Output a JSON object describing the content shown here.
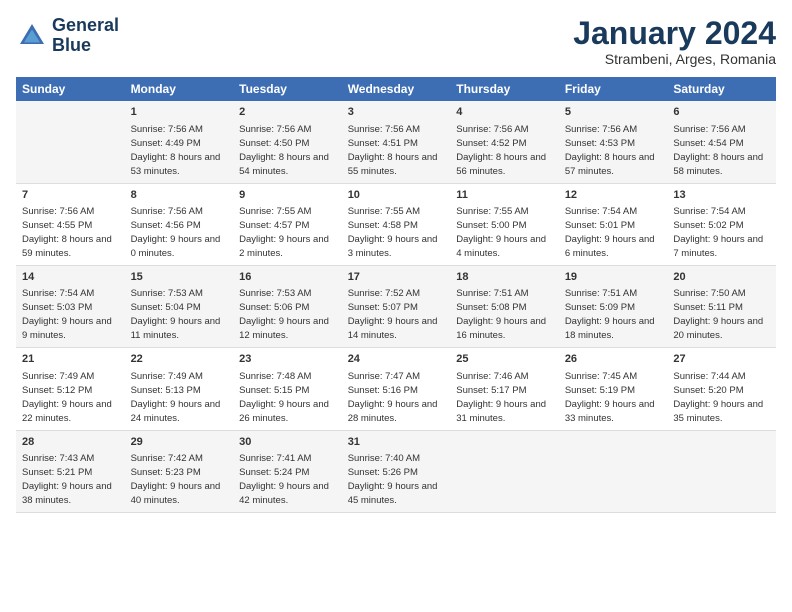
{
  "header": {
    "logo_line1": "General",
    "logo_line2": "Blue",
    "month_title": "January 2024",
    "subtitle": "Strambeni, Arges, Romania"
  },
  "weekdays": [
    "Sunday",
    "Monday",
    "Tuesday",
    "Wednesday",
    "Thursday",
    "Friday",
    "Saturday"
  ],
  "weeks": [
    [
      {
        "day": "",
        "sunrise": "",
        "sunset": "",
        "daylight": ""
      },
      {
        "day": "1",
        "sunrise": "Sunrise: 7:56 AM",
        "sunset": "Sunset: 4:49 PM",
        "daylight": "Daylight: 8 hours and 53 minutes."
      },
      {
        "day": "2",
        "sunrise": "Sunrise: 7:56 AM",
        "sunset": "Sunset: 4:50 PM",
        "daylight": "Daylight: 8 hours and 54 minutes."
      },
      {
        "day": "3",
        "sunrise": "Sunrise: 7:56 AM",
        "sunset": "Sunset: 4:51 PM",
        "daylight": "Daylight: 8 hours and 55 minutes."
      },
      {
        "day": "4",
        "sunrise": "Sunrise: 7:56 AM",
        "sunset": "Sunset: 4:52 PM",
        "daylight": "Daylight: 8 hours and 56 minutes."
      },
      {
        "day": "5",
        "sunrise": "Sunrise: 7:56 AM",
        "sunset": "Sunset: 4:53 PM",
        "daylight": "Daylight: 8 hours and 57 minutes."
      },
      {
        "day": "6",
        "sunrise": "Sunrise: 7:56 AM",
        "sunset": "Sunset: 4:54 PM",
        "daylight": "Daylight: 8 hours and 58 minutes."
      }
    ],
    [
      {
        "day": "7",
        "sunrise": "Sunrise: 7:56 AM",
        "sunset": "Sunset: 4:55 PM",
        "daylight": "Daylight: 8 hours and 59 minutes."
      },
      {
        "day": "8",
        "sunrise": "Sunrise: 7:56 AM",
        "sunset": "Sunset: 4:56 PM",
        "daylight": "Daylight: 9 hours and 0 minutes."
      },
      {
        "day": "9",
        "sunrise": "Sunrise: 7:55 AM",
        "sunset": "Sunset: 4:57 PM",
        "daylight": "Daylight: 9 hours and 2 minutes."
      },
      {
        "day": "10",
        "sunrise": "Sunrise: 7:55 AM",
        "sunset": "Sunset: 4:58 PM",
        "daylight": "Daylight: 9 hours and 3 minutes."
      },
      {
        "day": "11",
        "sunrise": "Sunrise: 7:55 AM",
        "sunset": "Sunset: 5:00 PM",
        "daylight": "Daylight: 9 hours and 4 minutes."
      },
      {
        "day": "12",
        "sunrise": "Sunrise: 7:54 AM",
        "sunset": "Sunset: 5:01 PM",
        "daylight": "Daylight: 9 hours and 6 minutes."
      },
      {
        "day": "13",
        "sunrise": "Sunrise: 7:54 AM",
        "sunset": "Sunset: 5:02 PM",
        "daylight": "Daylight: 9 hours and 7 minutes."
      }
    ],
    [
      {
        "day": "14",
        "sunrise": "Sunrise: 7:54 AM",
        "sunset": "Sunset: 5:03 PM",
        "daylight": "Daylight: 9 hours and 9 minutes."
      },
      {
        "day": "15",
        "sunrise": "Sunrise: 7:53 AM",
        "sunset": "Sunset: 5:04 PM",
        "daylight": "Daylight: 9 hours and 11 minutes."
      },
      {
        "day": "16",
        "sunrise": "Sunrise: 7:53 AM",
        "sunset": "Sunset: 5:06 PM",
        "daylight": "Daylight: 9 hours and 12 minutes."
      },
      {
        "day": "17",
        "sunrise": "Sunrise: 7:52 AM",
        "sunset": "Sunset: 5:07 PM",
        "daylight": "Daylight: 9 hours and 14 minutes."
      },
      {
        "day": "18",
        "sunrise": "Sunrise: 7:51 AM",
        "sunset": "Sunset: 5:08 PM",
        "daylight": "Daylight: 9 hours and 16 minutes."
      },
      {
        "day": "19",
        "sunrise": "Sunrise: 7:51 AM",
        "sunset": "Sunset: 5:09 PM",
        "daylight": "Daylight: 9 hours and 18 minutes."
      },
      {
        "day": "20",
        "sunrise": "Sunrise: 7:50 AM",
        "sunset": "Sunset: 5:11 PM",
        "daylight": "Daylight: 9 hours and 20 minutes."
      }
    ],
    [
      {
        "day": "21",
        "sunrise": "Sunrise: 7:49 AM",
        "sunset": "Sunset: 5:12 PM",
        "daylight": "Daylight: 9 hours and 22 minutes."
      },
      {
        "day": "22",
        "sunrise": "Sunrise: 7:49 AM",
        "sunset": "Sunset: 5:13 PM",
        "daylight": "Daylight: 9 hours and 24 minutes."
      },
      {
        "day": "23",
        "sunrise": "Sunrise: 7:48 AM",
        "sunset": "Sunset: 5:15 PM",
        "daylight": "Daylight: 9 hours and 26 minutes."
      },
      {
        "day": "24",
        "sunrise": "Sunrise: 7:47 AM",
        "sunset": "Sunset: 5:16 PM",
        "daylight": "Daylight: 9 hours and 28 minutes."
      },
      {
        "day": "25",
        "sunrise": "Sunrise: 7:46 AM",
        "sunset": "Sunset: 5:17 PM",
        "daylight": "Daylight: 9 hours and 31 minutes."
      },
      {
        "day": "26",
        "sunrise": "Sunrise: 7:45 AM",
        "sunset": "Sunset: 5:19 PM",
        "daylight": "Daylight: 9 hours and 33 minutes."
      },
      {
        "day": "27",
        "sunrise": "Sunrise: 7:44 AM",
        "sunset": "Sunset: 5:20 PM",
        "daylight": "Daylight: 9 hours and 35 minutes."
      }
    ],
    [
      {
        "day": "28",
        "sunrise": "Sunrise: 7:43 AM",
        "sunset": "Sunset: 5:21 PM",
        "daylight": "Daylight: 9 hours and 38 minutes."
      },
      {
        "day": "29",
        "sunrise": "Sunrise: 7:42 AM",
        "sunset": "Sunset: 5:23 PM",
        "daylight": "Daylight: 9 hours and 40 minutes."
      },
      {
        "day": "30",
        "sunrise": "Sunrise: 7:41 AM",
        "sunset": "Sunset: 5:24 PM",
        "daylight": "Daylight: 9 hours and 42 minutes."
      },
      {
        "day": "31",
        "sunrise": "Sunrise: 7:40 AM",
        "sunset": "Sunset: 5:26 PM",
        "daylight": "Daylight: 9 hours and 45 minutes."
      },
      {
        "day": "",
        "sunrise": "",
        "sunset": "",
        "daylight": ""
      },
      {
        "day": "",
        "sunrise": "",
        "sunset": "",
        "daylight": ""
      },
      {
        "day": "",
        "sunrise": "",
        "sunset": "",
        "daylight": ""
      }
    ]
  ]
}
